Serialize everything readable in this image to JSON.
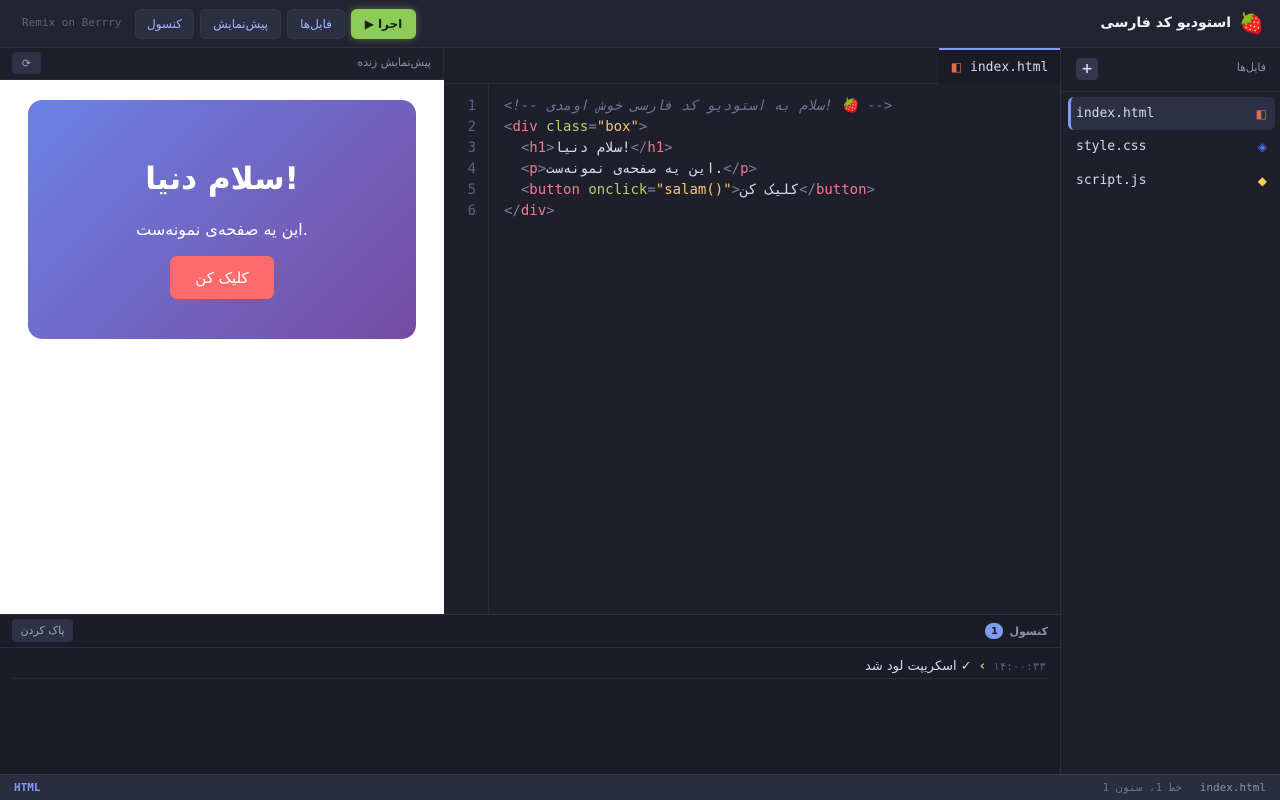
{
  "app": {
    "logo": "🍓",
    "title": "استودیو کد فارسی",
    "remix_label": "Remix on Berrry"
  },
  "toolbar": {
    "run_label": "اجرا",
    "files_label": "فایل‌ها",
    "preview_label": "پیش‌نمایش",
    "console_label": "کنسول"
  },
  "sidebar": {
    "title": "فایل‌ها",
    "add_label": "+",
    "files": [
      {
        "name": "index.html",
        "icon": "◧",
        "icon_color": "#e06c4a",
        "active": true
      },
      {
        "name": "style.css",
        "icon": "◈",
        "icon_color": "#4b7bf5",
        "active": false
      },
      {
        "name": "script.js",
        "icon": "◆",
        "icon_color": "#f0d34a",
        "active": false
      }
    ]
  },
  "editor": {
    "tab_name": "index.html",
    "tab_icon": "◧",
    "line_numbers": [
      "1",
      "2",
      "3",
      "4",
      "5",
      "6"
    ],
    "code": {
      "l1_comment": "<!-- سلام به استودیو کد فارسی خوش اومدی! 🍓 -->",
      "l2_attr": "class",
      "l2_val": "\"box\"",
      "l3_text": "سلام دنیا!",
      "l4_text": "این یه صفحه‌ی نمونه‌ست.",
      "l5_attr": "onclick",
      "l5_val": "\"salam()\"",
      "l5_text": "کلیک کن"
    }
  },
  "preview": {
    "title": "پیش‌نمایش زنده",
    "refresh_icon": "⟳",
    "heading": "سلام دنیا!",
    "paragraph": "این یه صفحه‌ی نمونه‌ست.",
    "button_label": "کلیک کن"
  },
  "console": {
    "title": "کنسول",
    "count": "1",
    "clear_label": "پاک کردن",
    "logs": [
      {
        "time": "۱۴:۰۰:۳۳",
        "arrow": "›",
        "message": "✓ اسکریپت لود شد"
      }
    ]
  },
  "status": {
    "file": "index.html",
    "position": "خط 1، ستون 1",
    "language": "HTML"
  },
  "colors": {
    "accent": "#7f9cf5",
    "run": "#8ccb57",
    "preview_button": "#ff6b6b"
  }
}
